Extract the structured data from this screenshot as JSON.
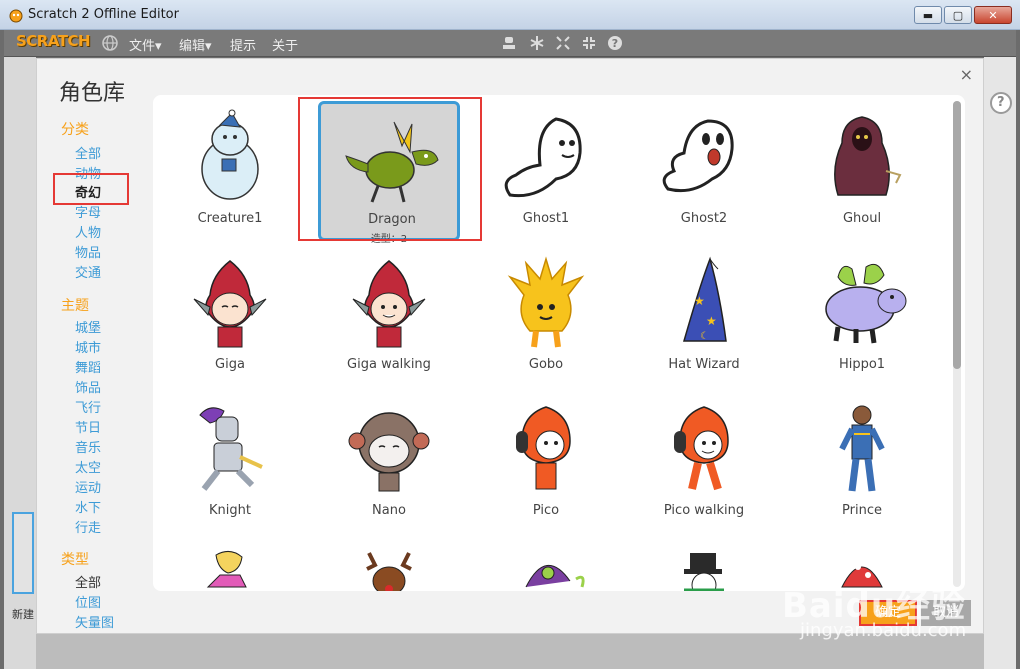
{
  "window": {
    "title": "Scratch 2 Offline Editor",
    "minimize": "▬",
    "maximize": "▢",
    "close": "✕"
  },
  "menubar": {
    "logo": "SCRATCH",
    "items": [
      "文件▾",
      "编辑▾",
      "提示",
      "关于"
    ]
  },
  "dialog": {
    "title": "角色库",
    "close": "×",
    "sections": {
      "category": {
        "header": "分类",
        "items": [
          "全部",
          "动物",
          "奇幻",
          "字母",
          "人物",
          "物品",
          "交通"
        ],
        "selected": "奇幻"
      },
      "theme": {
        "header": "主题",
        "items": [
          "城堡",
          "城市",
          "舞蹈",
          "饰品",
          "飞行",
          "节日",
          "音乐",
          "太空",
          "运动",
          "水下",
          "行走"
        ]
      },
      "type": {
        "header": "类型",
        "items": [
          "全部",
          "位图",
          "矢量图"
        ],
        "selected": "全部"
      }
    },
    "sprites": [
      {
        "name": "Creature1"
      },
      {
        "name": "Dragon",
        "sub": "造型：2",
        "selected": true
      },
      {
        "name": "Ghost1"
      },
      {
        "name": "Ghost2"
      },
      {
        "name": "Ghoul"
      },
      {
        "name": "Giga"
      },
      {
        "name": "Giga walking"
      },
      {
        "name": "Gobo"
      },
      {
        "name": "Hat Wizard"
      },
      {
        "name": "Hippo1"
      },
      {
        "name": "Knight"
      },
      {
        "name": "Nano"
      },
      {
        "name": "Pico"
      },
      {
        "name": "Pico walking"
      },
      {
        "name": "Prince"
      }
    ],
    "ok_label": "确定",
    "cancel_label": "取消"
  },
  "background": {
    "new_label": "新建"
  },
  "watermark": {
    "brand": "Baidu经验",
    "url": "jingyan.baidu.com"
  },
  "colors": {
    "accent_orange": "#f7a11b",
    "link_blue": "#3d9bd6",
    "highlight_red": "#e53935"
  }
}
